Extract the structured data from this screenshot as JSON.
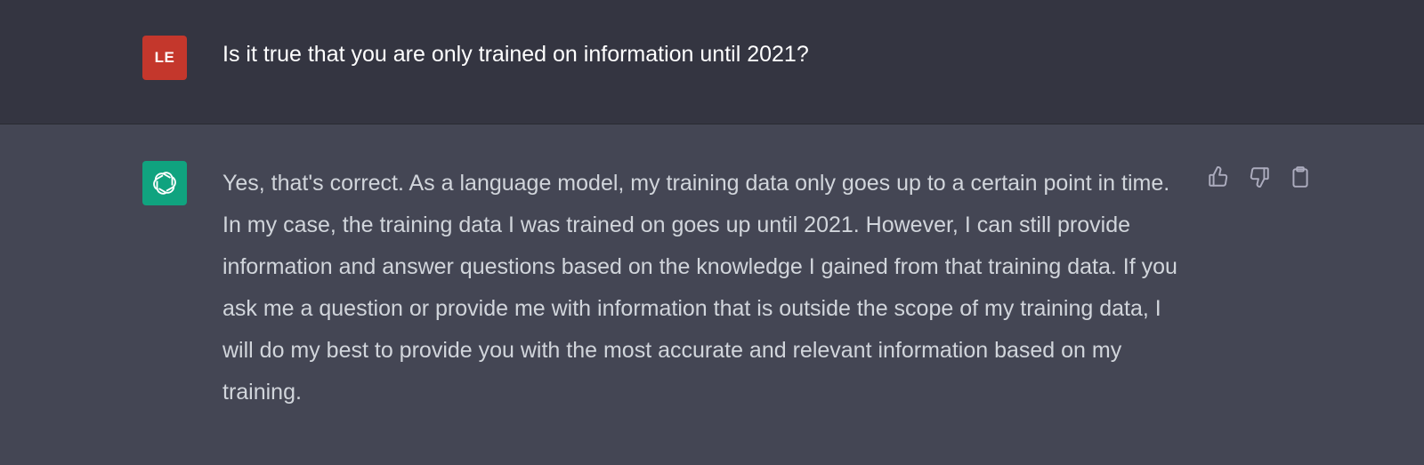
{
  "conversation": {
    "user_message": {
      "avatar_initials": "LE",
      "avatar_color": "#c4372c",
      "text": "Is it true that you are only trained on information until 2021?"
    },
    "assistant_message": {
      "avatar_icon": "openai-logo-icon",
      "avatar_color": "#10a37f",
      "text": "Yes, that's correct. As a language model, my training data only goes up to a certain point in time. In my case, the training data I was trained on goes up until 2021. However, I can still provide information and answer questions based on the knowledge I gained from that training data. If you ask me a question or provide me with information that is outside the scope of my training data, I will do my best to provide you with the most accurate and relevant information based on my training.",
      "actions": [
        {
          "icon": "thumbs-up-icon"
        },
        {
          "icon": "thumbs-down-icon"
        },
        {
          "icon": "clipboard-icon"
        }
      ]
    }
  }
}
